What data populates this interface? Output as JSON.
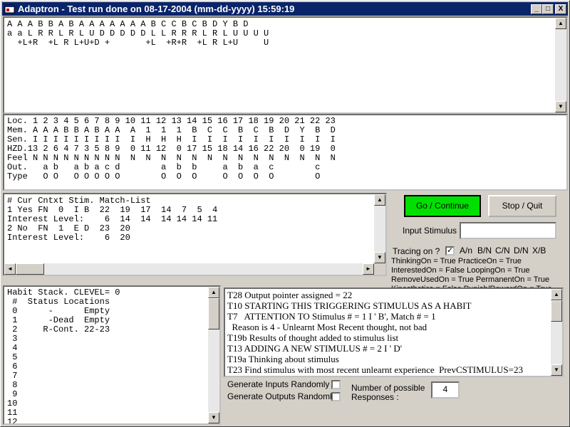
{
  "window": {
    "title": "Adaptron  -  Test run done on 08-17-2004 (mm-dd-yyyy) 15:59:19",
    "min_label": "_",
    "max_label": "□",
    "close_label": "X"
  },
  "sequence_panel": {
    "lines": [
      "A A A B B A B A A A A A A A B C C B C B D Y B D",
      "a a L R R L R L U D D D D D L L R R R L R L U U U U",
      "  +L+R  +L R L+U+D +       +L  +R+R  +L R L+U     U"
    ]
  },
  "memory_panel": {
    "lines": [
      "Loc. 1 2 3 4 5 6 7 8 9 10 11 12 13 14 15 16 17 18 19 20 21 22 23",
      "Mem. A A A B B A B A A  A  1  1  1  B  C  C  B  C  B  D  Y  B  D",
      "Sen. I I I I I I I I I  I  H  H  H  I  I  I  I  I  I  I  I  I  I",
      "HZD.13 2 6 4 7 3 5 8 9  0 11 12  0 17 15 18 14 16 22 20  0 19  0",
      "Feel N N N N N N N N N  N  N  N  N  N  N  N  N  N  N  N  N  N  N",
      "Out.   a b   a b a c d        a  b  b     a  b  a  c        c",
      "Type   O O   O O O O O        O  O  O     O  O  O  O        O"
    ]
  },
  "match_panel": {
    "lines": [
      "# Cur Cntxt Stim. Match-List",
      "1 Yes FN  0  I B  22  19  17  14  7  5  4",
      "Interest Level:    6  14  14  14 14 14 11",
      "2 No  FN  1  E D  23  20",
      "Interest Level:    6  20"
    ]
  },
  "habit_panel": {
    "lines": [
      "Habit Stack. CLEVEL= 0",
      " #  Status Locations",
      " 0      -      Empty",
      " 1      -Dead  Empty",
      " 2     R-Cont. 22-23",
      " 3",
      " 4",
      " 5",
      " 6",
      " 7",
      " 8",
      " 9",
      "10",
      "11",
      "12"
    ]
  },
  "trace_panel": {
    "lines": [
      "T28 Output pointer assigned = 22",
      "T10 STARTING THIS TRIGGERING STIMULUS AS A HABIT",
      "T7   ATTENTION TO Stimulus # = 1 I ' B', Match # = 1",
      "  Reason is 4 - Unlearnt Most Recent thought, not bad",
      "T19b Results of thought added to stimulus list",
      "T13 ADDING A NEW STIMULUS # = 2 I ' D'",
      "T19a Thinking about stimulus",
      "T23 Find stimulus with most recent unlearnt experience  PrevCSTIMULUS=23"
    ]
  },
  "controls": {
    "go_label": "Go / Continue",
    "stop_label": "Stop / Quit",
    "input_stimulus_label": "Input Stimulus :",
    "input_stimulus_value": "",
    "tracing_label": "Tracing on ?",
    "tracing_checked": "✓",
    "tracing_options": [
      "A/n",
      "B/N",
      "C/N",
      "D/N",
      "X/B"
    ],
    "status_lines": [
      "ThinkingOn = True PracticeOn = True",
      "InterestedOn = False LoopingOn = True",
      "RemoveUsedOn = True PermanentOn = True",
      "Kinesthetics = False Punish/RewardOn = True"
    ],
    "gen_inputs_label": "Generate Inputs Randomly ?",
    "gen_outputs_label": "Generate Outputs Randomly?",
    "num_responses_label_1": "Number of possible",
    "num_responses_label_2": "Responses :",
    "num_responses_value": "4"
  },
  "colors": {
    "go_button": "#00e000",
    "title_bar": "#0a246a"
  }
}
